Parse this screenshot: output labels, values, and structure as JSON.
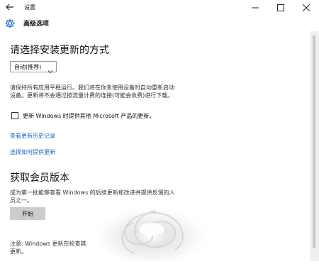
{
  "window": {
    "title": "设置",
    "back_icon": "back-arrow-icon",
    "min_icon": "minimize-icon",
    "max_icon": "maximize-icon",
    "close_icon": "close-icon"
  },
  "header": {
    "icon": "gear-icon",
    "title": "高级选项",
    "accent": "#1a66c4"
  },
  "install_section": {
    "heading": "请选择安装更新的方式",
    "dropdown_value": "自动(推荐)",
    "description_line1": "请保持所有应用平稳运行。我们将在你未使用设备时自动重新启动",
    "description_line2": "设备。更新将不会通过按流量计费的连接(可能会收费)进行下载。",
    "checkbox_label": "更新 Windows 时提供其他 Microsoft 产品的更新。",
    "checkbox_checked": false
  },
  "links": {
    "history": "查看更新历史记录",
    "choose_delivery": "选择如何提供更新"
  },
  "insider_section": {
    "heading": "获取会员版本",
    "description_line1": "成为第一批能够查看 Windows 的后续更新和改进并提供反馈的人",
    "description_line2": "员之一。",
    "start_button": "开始"
  },
  "note": {
    "line1": "注意: Windows 更新在检查其",
    "line2": "更新。"
  },
  "colors": {
    "link": "#1a66c4",
    "button_bg": "#cccccc"
  }
}
